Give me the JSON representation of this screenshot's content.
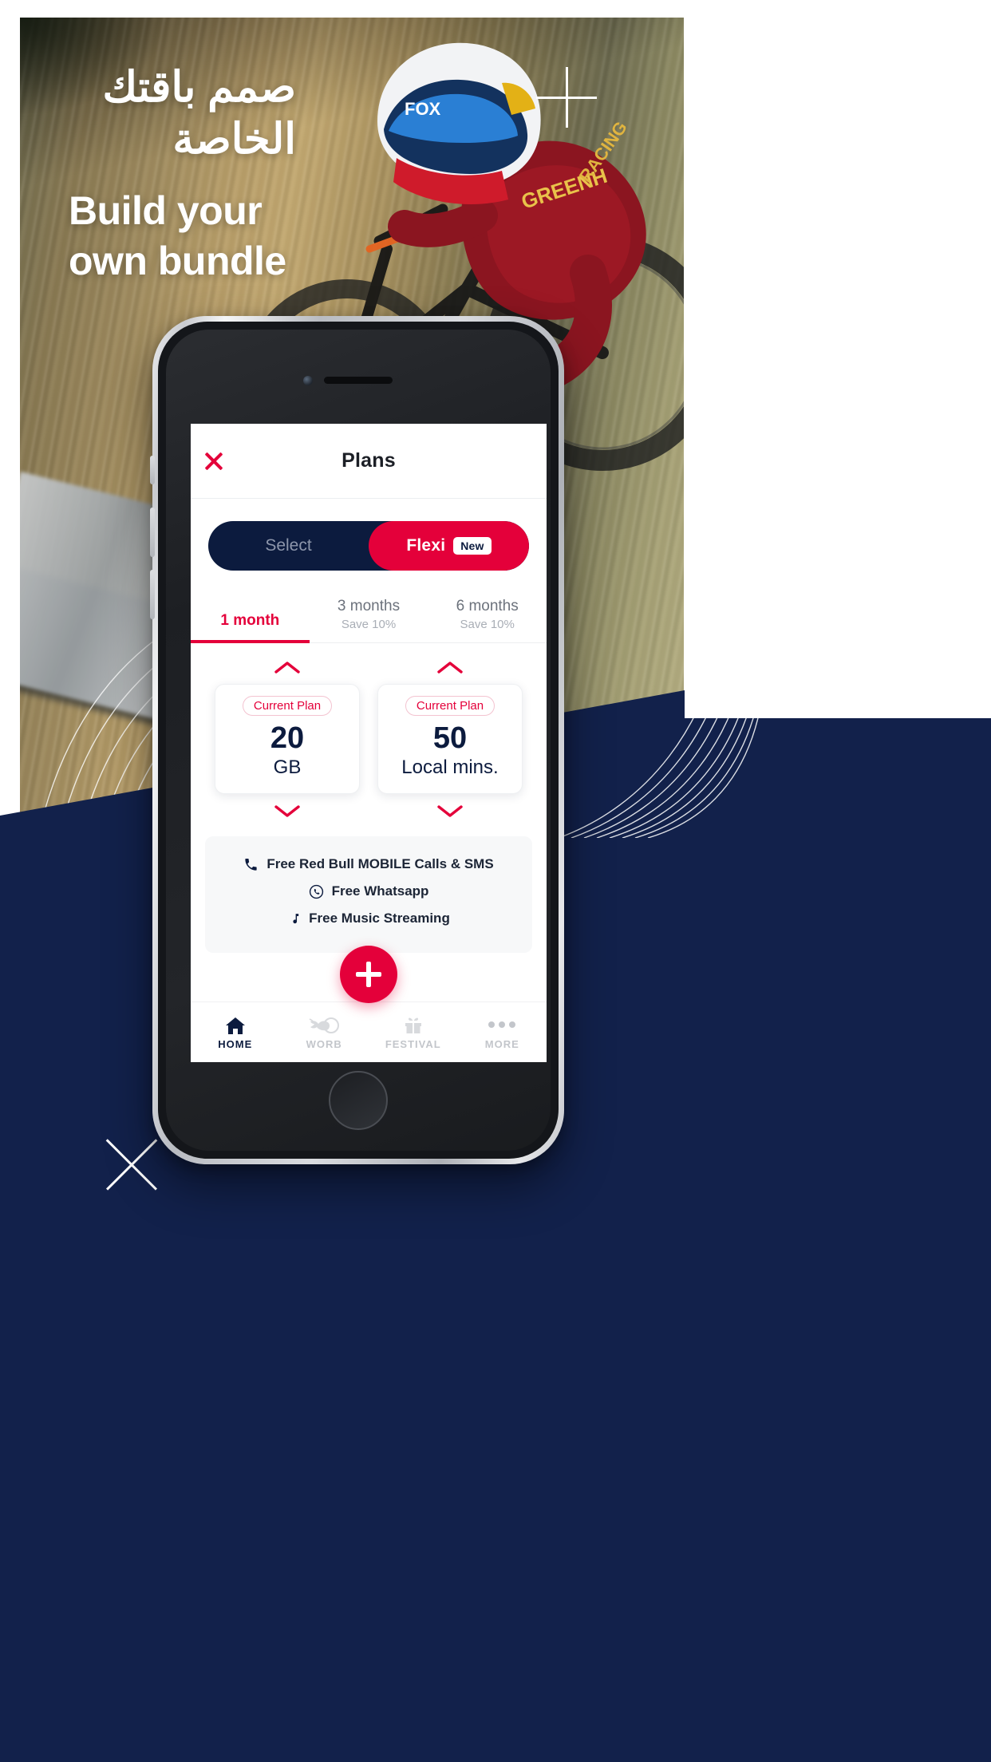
{
  "poster": {
    "heading_ar": "صمم باقتك الخاصة",
    "heading_en_line1": "Build your",
    "heading_en_line2": "own bundle",
    "colors": {
      "navy": "#12214B",
      "crimson": "#E4003A",
      "toggle_navy": "#0C1B3E",
      "white": "#FFFFFF"
    },
    "marks": {
      "plus": "plus-mark",
      "x": "x-mark"
    }
  },
  "app": {
    "header": {
      "close_icon": "close-icon",
      "title": "Plans"
    },
    "segmented": {
      "inactive_label": "Select",
      "active_label": "Flexi",
      "active_badge": "New"
    },
    "period_tabs": [
      {
        "label": "1 month",
        "sub": "",
        "active": true
      },
      {
        "label": "3 months",
        "sub": "Save 10%",
        "active": false
      },
      {
        "label": "6 months",
        "sub": "Save 10%",
        "active": false
      }
    ],
    "plan_cards": [
      {
        "badge": "Current Plan",
        "value": "20",
        "unit": "GB",
        "up_icon": "chevron-up-icon",
        "down_icon": "chevron-down-icon"
      },
      {
        "badge": "Current Plan",
        "value": "50",
        "unit": "Local mins.",
        "up_icon": "chevron-up-icon",
        "down_icon": "chevron-down-icon"
      }
    ],
    "benefits": [
      {
        "icon": "phone-icon",
        "label": "Free Red Bull MOBILE Calls & SMS"
      },
      {
        "icon": "whatsapp-icon",
        "label": "Free Whatsapp"
      },
      {
        "icon": "music-note-icon",
        "label": "Free Music Streaming"
      }
    ],
    "fab": {
      "icon": "plus-icon"
    },
    "bottom_nav": [
      {
        "label": "HOME",
        "icon": "home-icon",
        "active": true
      },
      {
        "label": "WORB",
        "icon": "bull-icon",
        "active": false
      },
      {
        "label": "FESTIVAL",
        "icon": "gift-icon",
        "active": false
      },
      {
        "label": "MORE",
        "icon": "more-dots-icon",
        "active": false
      }
    ]
  }
}
